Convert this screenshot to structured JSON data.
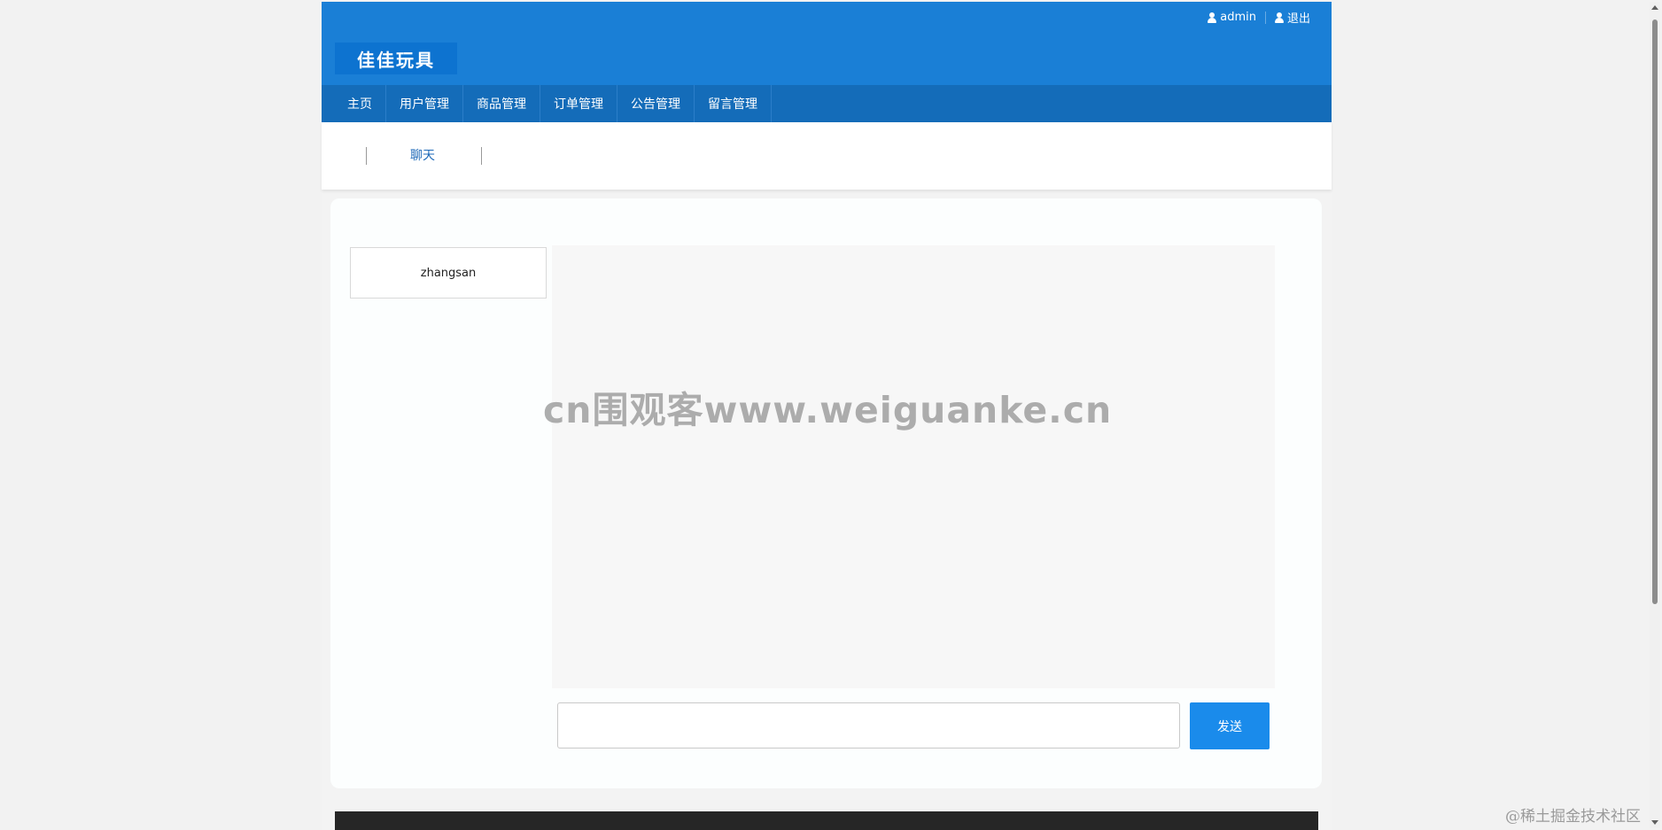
{
  "header": {
    "top_links": [
      {
        "label": "admin",
        "icon": "user-icon"
      },
      {
        "label": "退出",
        "icon": "user-icon"
      }
    ],
    "logo_text": "佳佳玩具",
    "colors": {
      "header": "#1a7fd6",
      "nav": "#146cb9",
      "accent": "#1a8beb"
    }
  },
  "nav": {
    "items": [
      "主页",
      "用户管理",
      "商品管理",
      "订单管理",
      "公告管理",
      "留言管理"
    ]
  },
  "breadcrumb": {
    "current": "聊天"
  },
  "chat": {
    "users": [
      "zhangsan"
    ],
    "input_value": "",
    "send_label": "发送"
  },
  "watermark": {
    "text": "cn围观客www.weiguanke.cn"
  },
  "corner_watermark": {
    "text": "@稀土掘金技术社区"
  }
}
